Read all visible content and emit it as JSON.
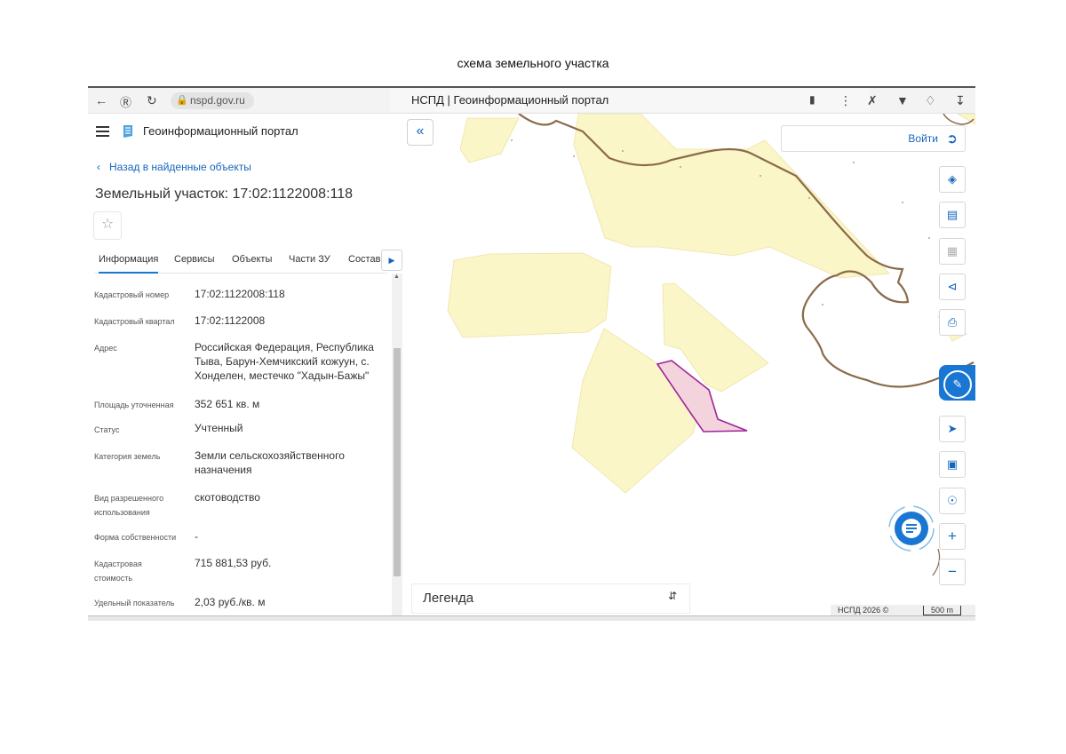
{
  "doc_title": "схема земельного участка",
  "browser": {
    "url": "nspd.gov.ru",
    "tab_title": "НСПД | Геоинформационный портал",
    "icons": [
      "back-arrow-icon",
      "yandex-icon",
      "reload-icon",
      "lock-icon",
      "bookmark-icon",
      "more-icon",
      "extension-icon",
      "extension-icon",
      "extension-icon",
      "download-icon"
    ]
  },
  "header": {
    "app_title": "Геоинформационный портал"
  },
  "panel": {
    "back_label": "Назад в найденные объекты",
    "object_title": "Земельный участок: 17:02:1122008:118",
    "tabs": [
      "Информация",
      "Сервисы",
      "Объекты",
      "Части ЗУ",
      "Состав"
    ],
    "fields": [
      {
        "label": "Кадастровый номер",
        "value": "17:02:1122008:118"
      },
      {
        "label": "Кадастровый квартал",
        "value": "17:02:1122008"
      },
      {
        "label": "Адрес",
        "value": "Российская Федерация, Республика Тыва, Барун-Хемчикский кожуун, с. Хонделен, местечко \"Хадын-Бажы\""
      },
      {
        "label": "Площадь уточненная",
        "value": "352 651 кв. м"
      },
      {
        "label": "Статус",
        "value": "Учтенный"
      },
      {
        "label": "Категория земель",
        "value": "Земли сельскохозяйственного назначения"
      },
      {
        "label": "Вид разрешенного использования",
        "value": "скотоводство"
      },
      {
        "label": "Форма собственности",
        "value": "-"
      },
      {
        "label": "Кадастровая стоимость",
        "value": "715 881,53 руб."
      },
      {
        "label": "Удельный показатель",
        "value": "2,03 руб./кв. м"
      }
    ]
  },
  "map": {
    "login_label": "Войти",
    "legend_label": "Легенда",
    "copyright": "НСПД 2026 ©",
    "scale": "500 m",
    "colors": {
      "parcel_fill": "#fbf6c8",
      "selected_fill": "#f3d3dc",
      "selected_stroke": "#a0249a",
      "river": "#8a6a4a",
      "accent": "#1976d2"
    }
  }
}
